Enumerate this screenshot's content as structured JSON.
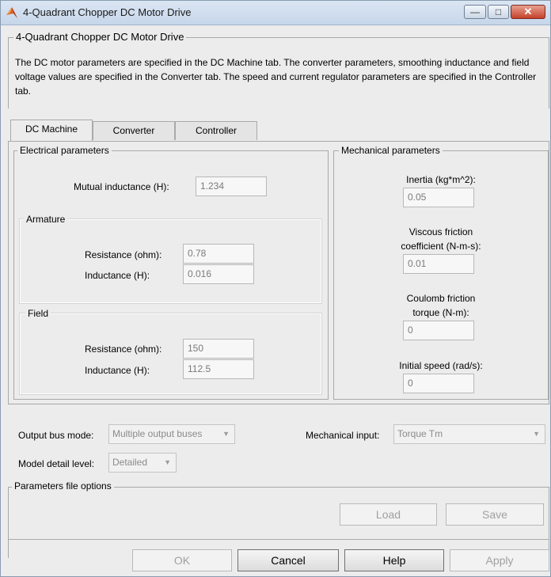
{
  "window": {
    "title": "4-Quadrant Chopper DC Motor Drive",
    "controls": {
      "minimize": "—",
      "maximize": "□",
      "close": "✕"
    }
  },
  "block": {
    "group_title": "4-Quadrant Chopper DC Motor Drive",
    "description": "The DC motor parameters are specified in the DC Machine tab. The converter parameters, smoothing inductance and field voltage values are specified in the Converter tab. The speed and current regulator parameters are specified in the Controller tab."
  },
  "tabs": [
    {
      "label": "DC Machine",
      "active": true
    },
    {
      "label": "Converter",
      "active": false
    },
    {
      "label": "Controller",
      "active": false
    }
  ],
  "electrical": {
    "title": "Electrical parameters",
    "mutual_label": "Mutual inductance (H):",
    "mutual_value": "1.234",
    "armature": {
      "title": "Armature",
      "resistance_label": "Resistance (ohm):",
      "resistance_value": "0.78",
      "inductance_label": "Inductance (H):",
      "inductance_value": "0.016"
    },
    "field": {
      "title": "Field",
      "resistance_label": "Resistance (ohm):",
      "resistance_value": "150",
      "inductance_label": "Inductance (H):",
      "inductance_value": "112.5"
    }
  },
  "mechanical": {
    "title": "Mechanical parameters",
    "inertia_label": "Inertia (kg*m^2):",
    "inertia_value": "0.05",
    "viscous_label_1": "Viscous friction",
    "viscous_label_2": "coefficient (N-m-s):",
    "viscous_value": "0.01",
    "coulomb_label_1": "Coulomb friction",
    "coulomb_label_2": "torque (N-m):",
    "coulomb_value": "0",
    "speed_label": "Initial speed (rad/s):",
    "speed_value": "0"
  },
  "options": {
    "output_bus_label": "Output bus mode:",
    "output_bus_value": "Multiple output buses",
    "mech_input_label": "Mechanical input:",
    "mech_input_value": "Torque Tm",
    "detail_label": "Model detail level:",
    "detail_value": "Detailed"
  },
  "params_file": {
    "title": "Parameters file options",
    "load": "Load",
    "save": "Save"
  },
  "footer": {
    "ok": "OK",
    "cancel": "Cancel",
    "help": "Help",
    "apply": "Apply"
  }
}
